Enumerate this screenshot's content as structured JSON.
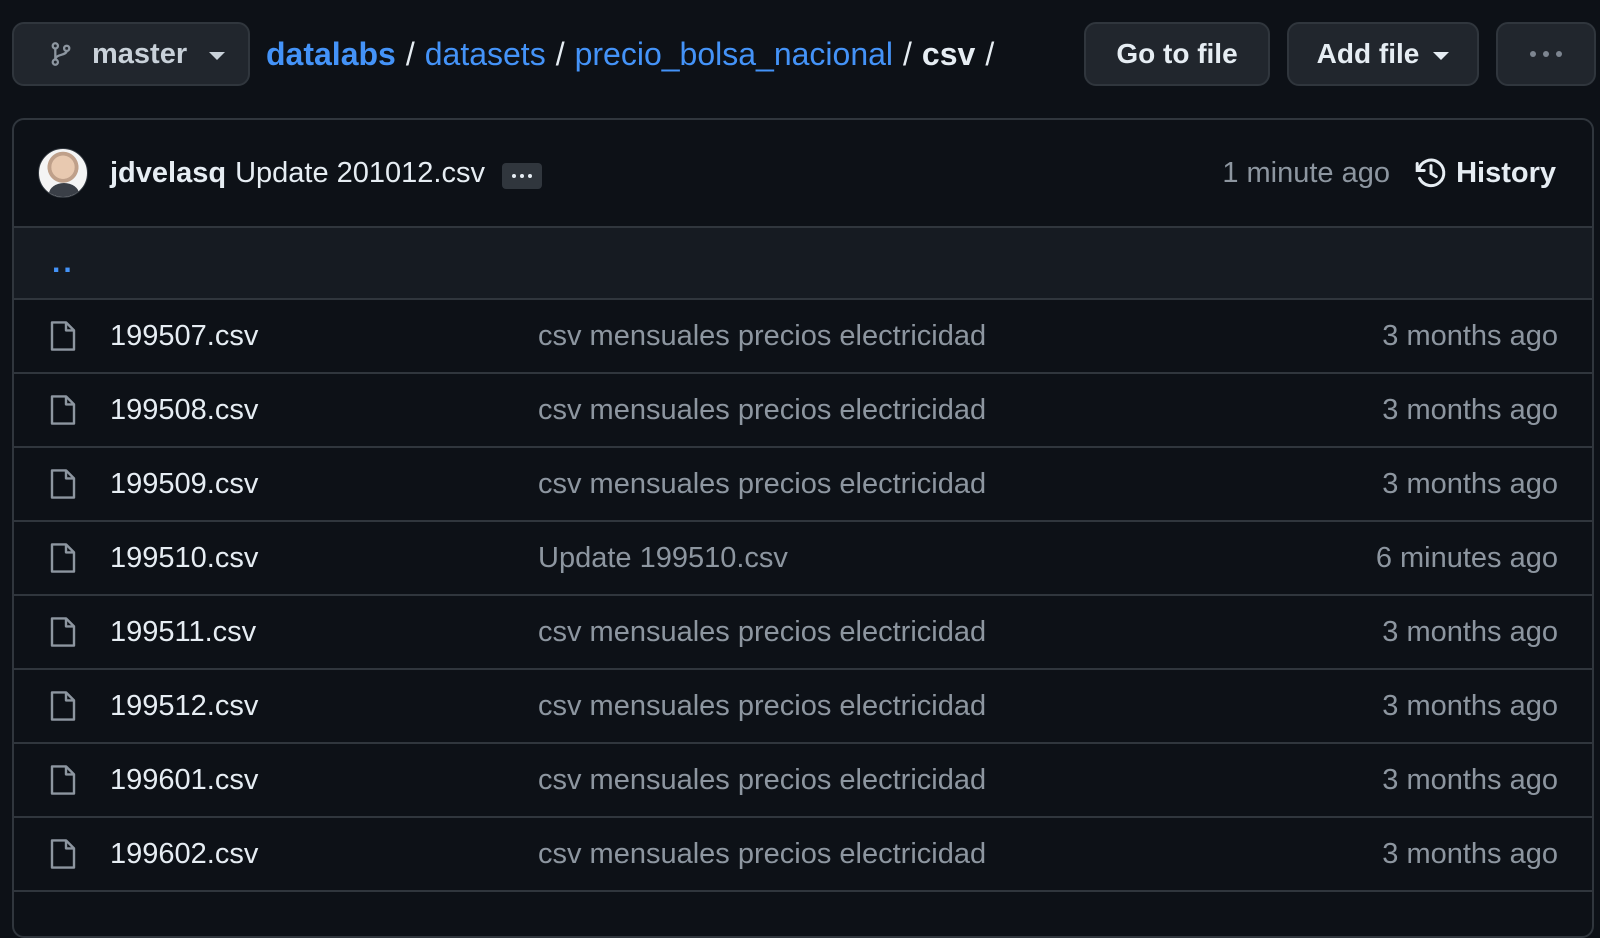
{
  "branch": {
    "name": "master"
  },
  "breadcrumb": {
    "repo": "datalabs",
    "parts": [
      "datasets",
      "precio_bolsa_nacional"
    ],
    "current": "csv",
    "separator": "/"
  },
  "actions": {
    "go_to_file": "Go to file",
    "add_file": "Add file"
  },
  "latest_commit": {
    "author": "jdvelasq",
    "message": "Update 201012.csv",
    "time": "1 minute ago",
    "history_label": "History"
  },
  "parent_dir_label": "..",
  "files": [
    {
      "name": "199507.csv",
      "message": "csv mensuales precios electricidad",
      "age": "3 months ago"
    },
    {
      "name": "199508.csv",
      "message": "csv mensuales precios electricidad",
      "age": "3 months ago"
    },
    {
      "name": "199509.csv",
      "message": "csv mensuales precios electricidad",
      "age": "3 months ago"
    },
    {
      "name": "199510.csv",
      "message": "Update 199510.csv",
      "age": "6 minutes ago"
    },
    {
      "name": "199511.csv",
      "message": "csv mensuales precios electricidad",
      "age": "3 months ago"
    },
    {
      "name": "199512.csv",
      "message": "csv mensuales precios electricidad",
      "age": "3 months ago"
    },
    {
      "name": "199601.csv",
      "message": "csv mensuales precios electricidad",
      "age": "3 months ago"
    },
    {
      "name": "199602.csv",
      "message": "csv mensuales precios electricidad",
      "age": "3 months ago"
    }
  ],
  "colors": {
    "background": "#0d1117",
    "link": "#4493f8",
    "muted": "#8d96a0",
    "border": "#30363d"
  },
  "icons": {
    "branch": "git-branch-icon",
    "history": "history-clock-icon",
    "file": "file-icon",
    "more": "kebab-horizontal-icon"
  }
}
